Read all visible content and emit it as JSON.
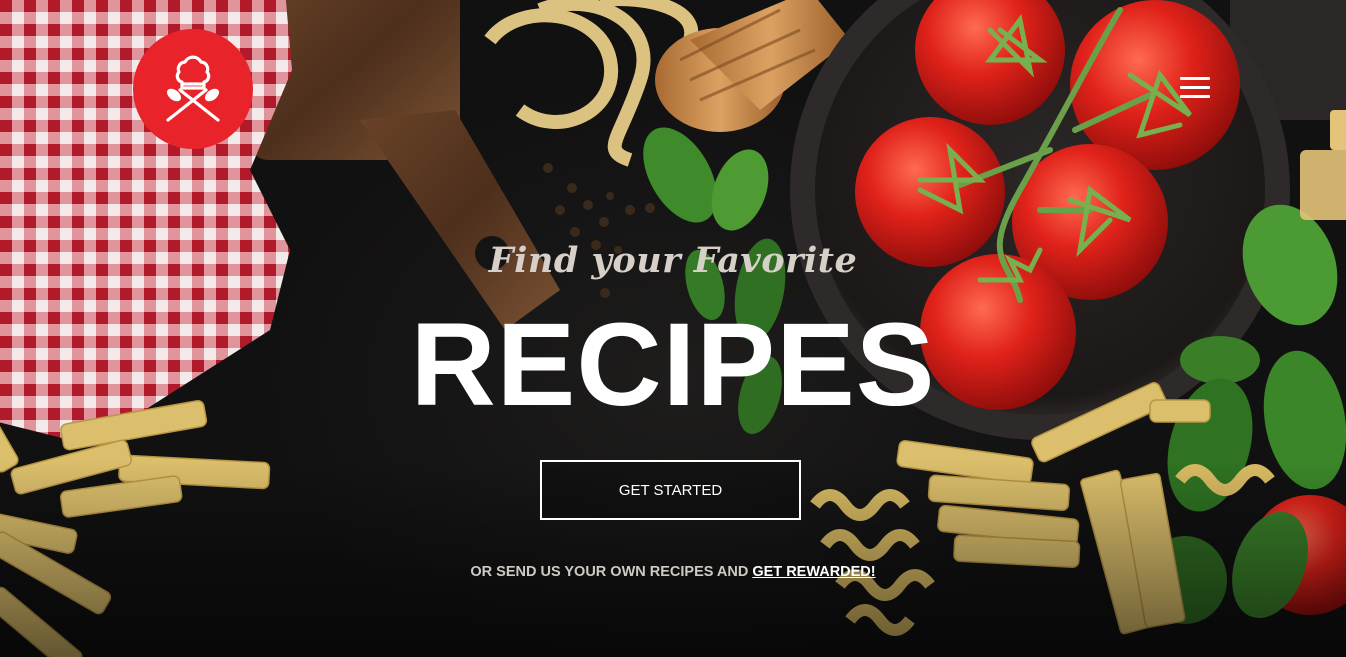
{
  "header": {
    "logo_icon": "chef-hat-crossed-spoons-icon",
    "menu_icon": "hamburger-menu-icon"
  },
  "hero": {
    "tagline": "Find your Favorite",
    "headline": "RECIPES",
    "cta_label": "GET STARTED",
    "subline_text": "OR SEND US YOUR OWN RECIPES AND ",
    "subline_link": "GET REWARDED!"
  },
  "colors": {
    "brand_red": "#e8232a",
    "text_white": "#ffffff",
    "background": "#151414"
  }
}
